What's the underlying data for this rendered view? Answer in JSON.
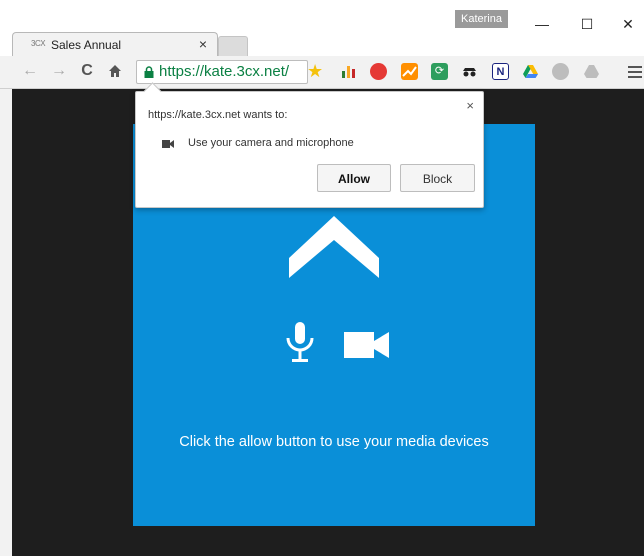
{
  "browser": {
    "profile_name": "Katerina",
    "tab": {
      "favicon_text": "3CX",
      "title": "Sales Annual",
      "close_glyph": "×"
    },
    "window_controls": {
      "minimize": "—",
      "maximize": "☐",
      "close": "✕"
    },
    "address_bar": {
      "url": "https://kate.3cx.net/"
    },
    "extension_icons": [
      "poll-icon",
      "pocket-icon",
      "chart-icon",
      "refresh-icon",
      "spy-icon",
      "notation-icon",
      "drive-icon",
      "gray-circle-icon",
      "gray-drive-icon"
    ]
  },
  "permission_popup": {
    "heading": "https://kate.3cx.net wants to:",
    "permission": "Use your camera and microphone",
    "allow_label": "Allow",
    "block_label": "Block",
    "close_glyph": "×"
  },
  "page": {
    "instruction": "Click the allow button to use your media devices"
  },
  "colors": {
    "card_blue": "#0a8fd8",
    "page_background": "#1e1e1e",
    "url_green": "#0b8043"
  }
}
